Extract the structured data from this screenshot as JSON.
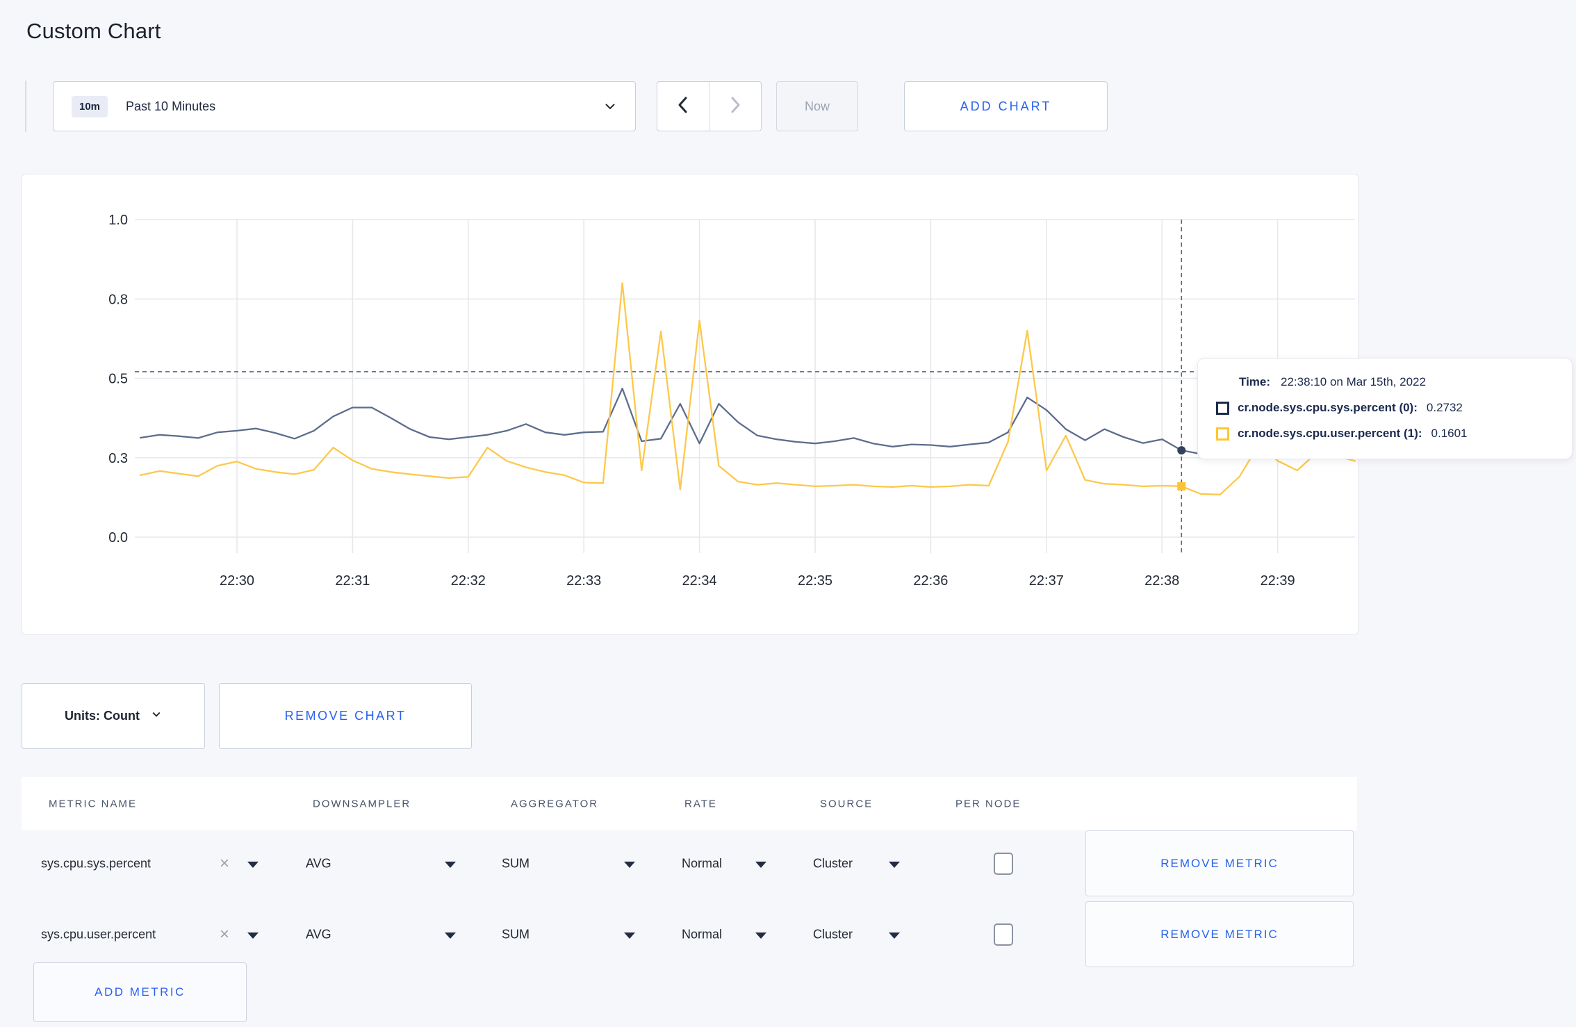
{
  "page": {
    "title": "Custom Chart"
  },
  "toolbar": {
    "time_window_badge": "10m",
    "time_window_label": "Past 10 Minutes",
    "now_label": "Now",
    "add_chart_label": "ADD CHART"
  },
  "chart_data": {
    "type": "line",
    "title": "",
    "xlabel": "",
    "ylabel": "",
    "ylim": [
      0,
      1
    ],
    "grid": true,
    "x_start": "22:29:10",
    "x_step_seconds": 10,
    "x_tick_labels": [
      "22:30",
      "22:31",
      "22:32",
      "22:33",
      "22:34",
      "22:35",
      "22:36",
      "22:37",
      "22:38",
      "22:39"
    ],
    "y_ticks": [
      {
        "value": 1.0,
        "label": "1.0"
      },
      {
        "value": 0.75,
        "label": "0.8"
      },
      {
        "value": 0.5,
        "label": "0.5"
      },
      {
        "value": 0.25,
        "label": "0.3"
      },
      {
        "value": 0.0,
        "label": "0.0"
      }
    ],
    "series": [
      {
        "name": "cr.node.sys.cpu.sys.percent (0)",
        "color": "#5d6d8d",
        "dot_color": "#33415e",
        "dot_shape": "circle",
        "values": [
          0.313,
          0.322,
          0.318,
          0.312,
          0.33,
          0.335,
          0.342,
          0.328,
          0.31,
          0.335,
          0.38,
          0.408,
          0.408,
          0.375,
          0.34,
          0.315,
          0.308,
          0.315,
          0.322,
          0.335,
          0.356,
          0.33,
          0.322,
          0.33,
          0.332,
          0.468,
          0.302,
          0.31,
          0.42,
          0.295,
          0.42,
          0.362,
          0.32,
          0.308,
          0.3,
          0.295,
          0.302,
          0.312,
          0.295,
          0.285,
          0.292,
          0.29,
          0.285,
          0.292,
          0.298,
          0.33,
          0.44,
          0.4,
          0.34,
          0.305,
          0.34,
          0.315,
          0.296,
          0.308,
          0.2732,
          0.262,
          0.285,
          0.3,
          0.295,
          0.3,
          0.305,
          0.298,
          0.295,
          0.33
        ]
      },
      {
        "name": "cr.node.sys.cpu.user.percent (1)",
        "color": "#fdc84b",
        "dot_color": "#fdc337",
        "dot_shape": "square",
        "values": [
          0.195,
          0.208,
          0.2,
          0.192,
          0.225,
          0.238,
          0.215,
          0.205,
          0.198,
          0.212,
          0.282,
          0.242,
          0.215,
          0.205,
          0.198,
          0.192,
          0.186,
          0.19,
          0.282,
          0.24,
          0.22,
          0.205,
          0.195,
          0.172,
          0.17,
          0.8,
          0.21,
          0.648,
          0.15,
          0.682,
          0.225,
          0.175,
          0.165,
          0.17,
          0.165,
          0.16,
          0.162,
          0.165,
          0.16,
          0.158,
          0.162,
          0.158,
          0.16,
          0.165,
          0.162,
          0.3,
          0.65,
          0.21,
          0.32,
          0.18,
          0.168,
          0.165,
          0.16,
          0.162,
          0.1601,
          0.136,
          0.134,
          0.19,
          0.29,
          0.24,
          0.21,
          0.265,
          0.255,
          0.24
        ]
      }
    ],
    "crosshair": {
      "time": "22:38:10",
      "x_index": 54,
      "hline_value": 0.521
    },
    "legend_position": "tooltip"
  },
  "tooltip": {
    "time_label": "Time:",
    "time_value": "22:38:10 on Mar 15th, 2022",
    "entries": [
      {
        "name": "cr.node.sys.cpu.sys.percent (0):",
        "value": "0.2732",
        "swatch_color": "#1b2a4e"
      },
      {
        "name": "cr.node.sys.cpu.user.percent (1):",
        "value": "0.1601",
        "swatch_color": "#ffc72e"
      }
    ]
  },
  "chart_controls": {
    "units_label": "Units: Count",
    "remove_chart_label": "REMOVE CHART"
  },
  "metrics_table": {
    "headers": {
      "metric_name": "METRIC NAME",
      "downsampler": "DOWNSAMPLER",
      "aggregator": "AGGREGATOR",
      "rate": "RATE",
      "source": "SOURCE",
      "per_node": "PER NODE"
    },
    "rows": [
      {
        "metric_name": "sys.cpu.sys.percent",
        "downsampler": "AVG",
        "aggregator": "SUM",
        "rate": "Normal",
        "source": "Cluster",
        "per_node_checked": false,
        "remove_label": "REMOVE METRIC"
      },
      {
        "metric_name": "sys.cpu.user.percent",
        "downsampler": "AVG",
        "aggregator": "SUM",
        "rate": "Normal",
        "source": "Cluster",
        "per_node_checked": false,
        "remove_label": "REMOVE METRIC"
      }
    ],
    "add_metric_label": "ADD METRIC"
  },
  "colors": {
    "accent_blue": "#2860f0",
    "line_sys": "#5d6d8d",
    "line_user": "#fdc84b",
    "page_bg": "#f6f7fa"
  }
}
